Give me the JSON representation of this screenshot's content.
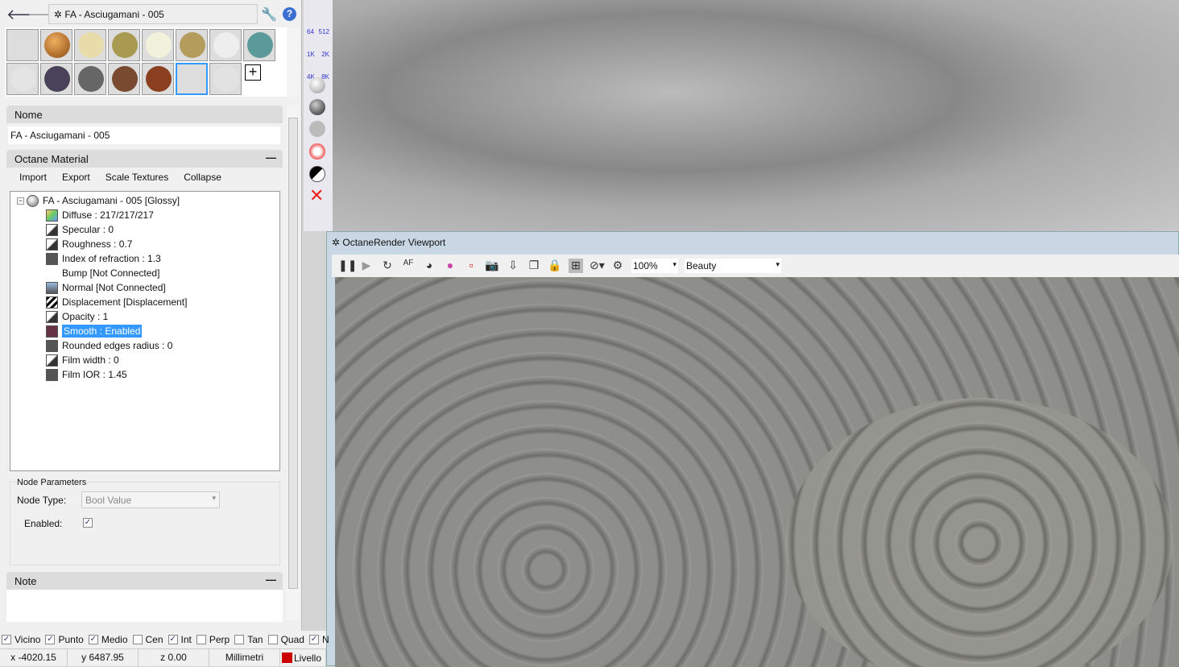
{
  "nav": {
    "title": "FA - Asciugamani - 005"
  },
  "panel": {
    "name_header": "Nome",
    "name_value": "FA - Asciugamani - 005",
    "octane_header": "Octane Material",
    "actions": [
      "Import",
      "Export",
      "Scale Textures",
      "Collapse"
    ],
    "tree_root": "FA - Asciugamani - 005  [Glossy]",
    "tree_items": [
      "Diffuse : 217/217/217",
      "Specular : 0",
      "Roughness : 0.7",
      "Index of refraction : 1.3",
      "Bump  [Not Connected]",
      "Normal  [Not Connected]",
      "Displacement  [Displacement]",
      "Opacity : 1",
      "Smooth : Enabled",
      "Rounded edges radius : 0",
      "Film width : 0",
      "Film IOR : 1.45"
    ],
    "node_params": "Node Parameters",
    "node_type_label": "Node Type:",
    "node_type_value": "Bool Value",
    "enabled_label": "Enabled:",
    "note_header": "Note"
  },
  "side_labels": [
    "64",
    "512",
    "1K",
    "2K",
    "4K",
    "8K"
  ],
  "viewport": {
    "title": "OctaneRender Viewport",
    "zoom": "100%",
    "pass": "Beauty"
  },
  "snaps": [
    {
      "label": "Vicino",
      "on": true
    },
    {
      "label": "Punto",
      "on": true
    },
    {
      "label": "Medio",
      "on": true
    },
    {
      "label": "Cen",
      "on": false
    },
    {
      "label": "Int",
      "on": true
    },
    {
      "label": "Perp",
      "on": false
    },
    {
      "label": "Tan",
      "on": false
    },
    {
      "label": "Quad",
      "on": false
    },
    {
      "label": "N",
      "on": true
    }
  ],
  "status": {
    "x": "x -4020.15",
    "y": "y 6487.95",
    "z": "z 0.00",
    "units": "Millimetri",
    "layer": "Livello",
    "layer_color": "#cc0000"
  },
  "colors": {
    "selection": "#3399ff"
  }
}
